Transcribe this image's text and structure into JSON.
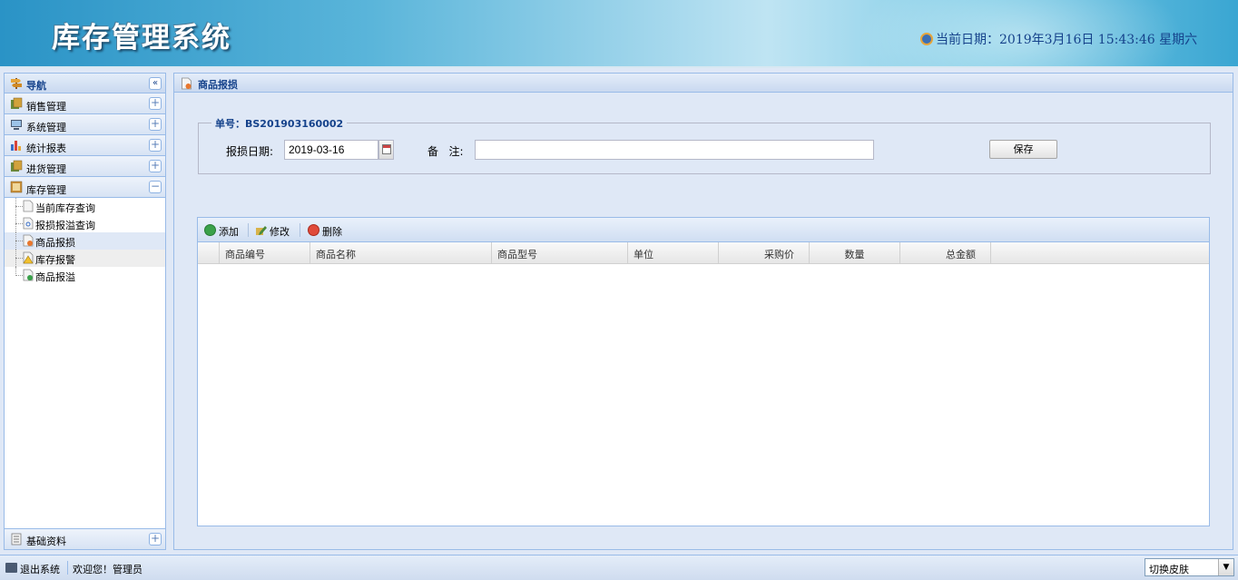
{
  "header": {
    "app_title": "库存管理系统",
    "date_text": "当前日期：2019年3月16日  15:43:46 星期六"
  },
  "nav": {
    "title": "导航",
    "sections": [
      {
        "label": "销售管理",
        "icon": "sales-icon"
      },
      {
        "label": "系统管理",
        "icon": "system-icon"
      },
      {
        "label": "统计报表",
        "icon": "chart-icon"
      },
      {
        "label": "进货管理",
        "icon": "purchase-icon"
      },
      {
        "label": "库存管理",
        "icon": "inventory-icon"
      }
    ],
    "inventory_items": [
      {
        "label": "当前库存查询"
      },
      {
        "label": "报损报溢查询"
      },
      {
        "label": "商品报损"
      },
      {
        "label": "库存报警"
      },
      {
        "label": "商品报溢"
      }
    ],
    "bottom_section": {
      "label": "基础资料",
      "icon": "basic-data-icon"
    }
  },
  "main": {
    "title": "商品报损",
    "form": {
      "order_legend": "单号：BS201903160002",
      "date_label": "报损日期:",
      "date_value": "2019-03-16",
      "remark_label": "备   注:",
      "remark_value": "",
      "save_label": "保存"
    },
    "toolbar": {
      "add_label": "添加",
      "edit_label": "修改",
      "delete_label": "删除"
    },
    "columns": [
      "商品编号",
      "商品名称",
      "商品型号",
      "单位",
      "采购价",
      "数量",
      "总金额"
    ],
    "rows": []
  },
  "footer": {
    "logout_label": "退出系统",
    "welcome_text": "欢迎您！管理员",
    "skin_selected": "切换皮肤"
  }
}
